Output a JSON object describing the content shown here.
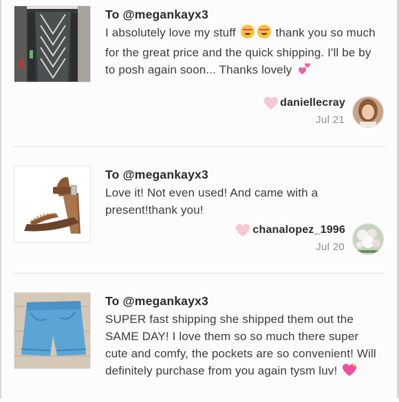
{
  "reviews": [
    {
      "to_label": "To @megankayx3",
      "text": "I absolutely love my stuff 😍😍 thank you so much for the great price and the quick shipping. I'll be by to posh again soon... Thanks lovely 💕",
      "text_parts": [
        "I absolutely love my stuff",
        "thank you so much for the great price and the quick shipping. I'll be by to posh again soon... Thanks lovely"
      ],
      "username": "daniellecray",
      "date": "Jul 21",
      "item_icon": "cardigan-photo",
      "avatar_icon": "user-avatar",
      "reaction_icon": "heart-icon"
    },
    {
      "to_label": "To @megankayx3",
      "text": "Love it! Not even used! And came with a present!thank you!",
      "username": "chanalopez_1996",
      "date": "Jul 20",
      "item_icon": "sandal-photo",
      "avatar_icon": "user-avatar",
      "reaction_icon": "heart-icon"
    },
    {
      "to_label": "To @megankayx3",
      "text": "SUPER fast shipping she shipped them out the SAME DAY! I love them so so much there super cute and comfy, the pockets are so convenient! Will definitely purchase from you again tysm luv! 💖",
      "text_parts": [
        "SUPER fast shipping she shipped them out the SAME DAY! I love them so so much there super cute and comfy, the pockets are so convenient! Will definitely purchase from you again tysm luv!"
      ],
      "item_icon": "shorts-photo"
    }
  ],
  "colors": {
    "background": "#fdfcfc",
    "heart": "#f7c8d2",
    "divider": "#dcdadb",
    "date": "#8e8e8e"
  }
}
